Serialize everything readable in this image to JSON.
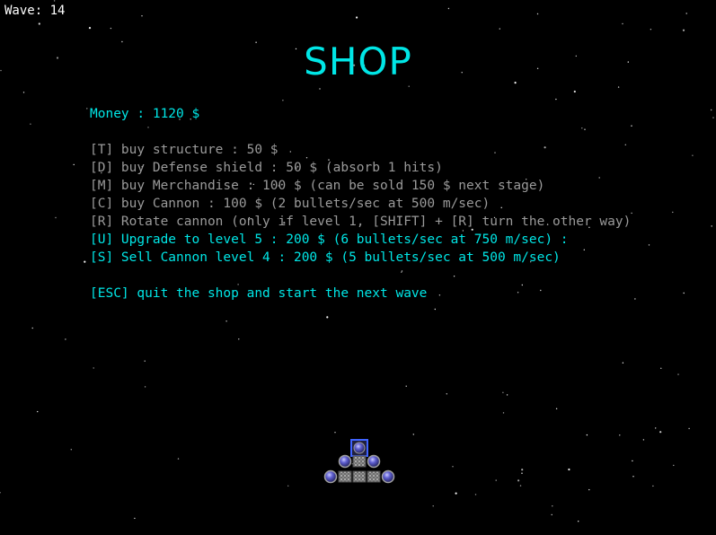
{
  "hud": {
    "wave_label": "Wave: 14"
  },
  "shop": {
    "title": "SHOP",
    "money": "Money : 1120 $",
    "options": [
      {
        "key": "T",
        "text": "[T] buy structure : 50 $",
        "enabled": false
      },
      {
        "key": "D",
        "text": "[D] buy Defense shield : 50 $ (absorb 1 hits)",
        "enabled": false
      },
      {
        "key": "M",
        "text": "[M] buy Merchandise : 100 $ (can be sold 150 $ next stage)",
        "enabled": false
      },
      {
        "key": "C",
        "text": "[C] buy Cannon : 100 $ (2 bullets/sec at 500 m/sec)",
        "enabled": false
      },
      {
        "key": "R",
        "text": "[R] Rotate cannon (only if level 1, [SHIFT] + [R] turn the other way)",
        "enabled": false
      },
      {
        "key": "U",
        "text": "[U] Upgrade to level 5 : 200 $ (6 bullets/sec at 750 m/sec) :",
        "enabled": true
      },
      {
        "key": "S",
        "text": "[S] Sell Cannon level 4 : 200 $ (5 bullets/sec at 500 m/sec)",
        "enabled": true
      }
    ],
    "quit": "[ESC] quit the shop and start the next wave"
  },
  "colors": {
    "background": "#000000",
    "active": "#00e6e6",
    "disabled": "#9a9a9a",
    "hud": "#ffffff"
  },
  "ship": {
    "icon": "player-ship-icon",
    "selected_block": "cannon"
  }
}
